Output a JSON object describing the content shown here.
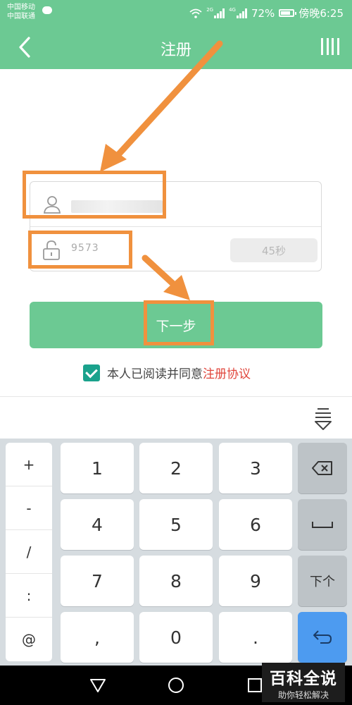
{
  "status_bar": {
    "carrier_1": "中国移动",
    "carrier_2": "中国联通",
    "net_1": "2G",
    "net_2": "4G",
    "battery": "72%",
    "time": "傍晚6:25"
  },
  "app_bar": {
    "title": "注册"
  },
  "form": {
    "phone_value": "",
    "code_value": "9573",
    "countdown_label": "45秒"
  },
  "next_button": {
    "label": "下一步"
  },
  "agreement": {
    "text": "本人已阅读并同意",
    "link": "注册协议",
    "checked": true
  },
  "keyboard": {
    "symbols": [
      "+",
      "-",
      "/",
      ":",
      "@"
    ],
    "rows": [
      [
        "1",
        "2",
        "3"
      ],
      [
        "4",
        "5",
        "6"
      ],
      [
        "7",
        "8",
        "9"
      ],
      [
        ",",
        "0",
        "."
      ]
    ],
    "next_label": "下个"
  },
  "watermark": {
    "title": "百科全说",
    "subtitle": "助你轻松解决"
  },
  "colors": {
    "brand_green": "#6cc993",
    "annotation_orange": "#f0913e",
    "link_red": "#e0453b",
    "check_teal": "#1aa28c",
    "enter_blue": "#4d9bf0"
  }
}
